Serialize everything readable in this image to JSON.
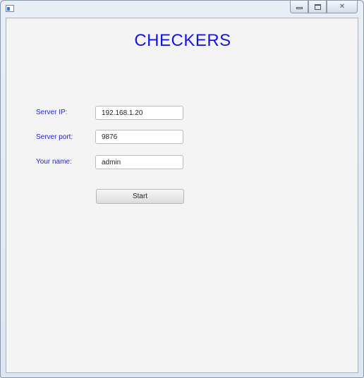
{
  "window": {
    "caption_buttons": {
      "minimize_icon": "minimize-icon",
      "maximize_icon": "maximize-icon",
      "close_glyph": "✕"
    }
  },
  "app": {
    "title": "CHECKERS",
    "title_color": "#1515e6",
    "label_color": "#2323d8"
  },
  "form": {
    "server_ip": {
      "label": "Server IP:",
      "value": "192.168.1.20"
    },
    "server_port": {
      "label": "Server port:",
      "value": "9876"
    },
    "player_name": {
      "label": "Your name:",
      "value": "admin"
    },
    "start_label": "Start"
  }
}
